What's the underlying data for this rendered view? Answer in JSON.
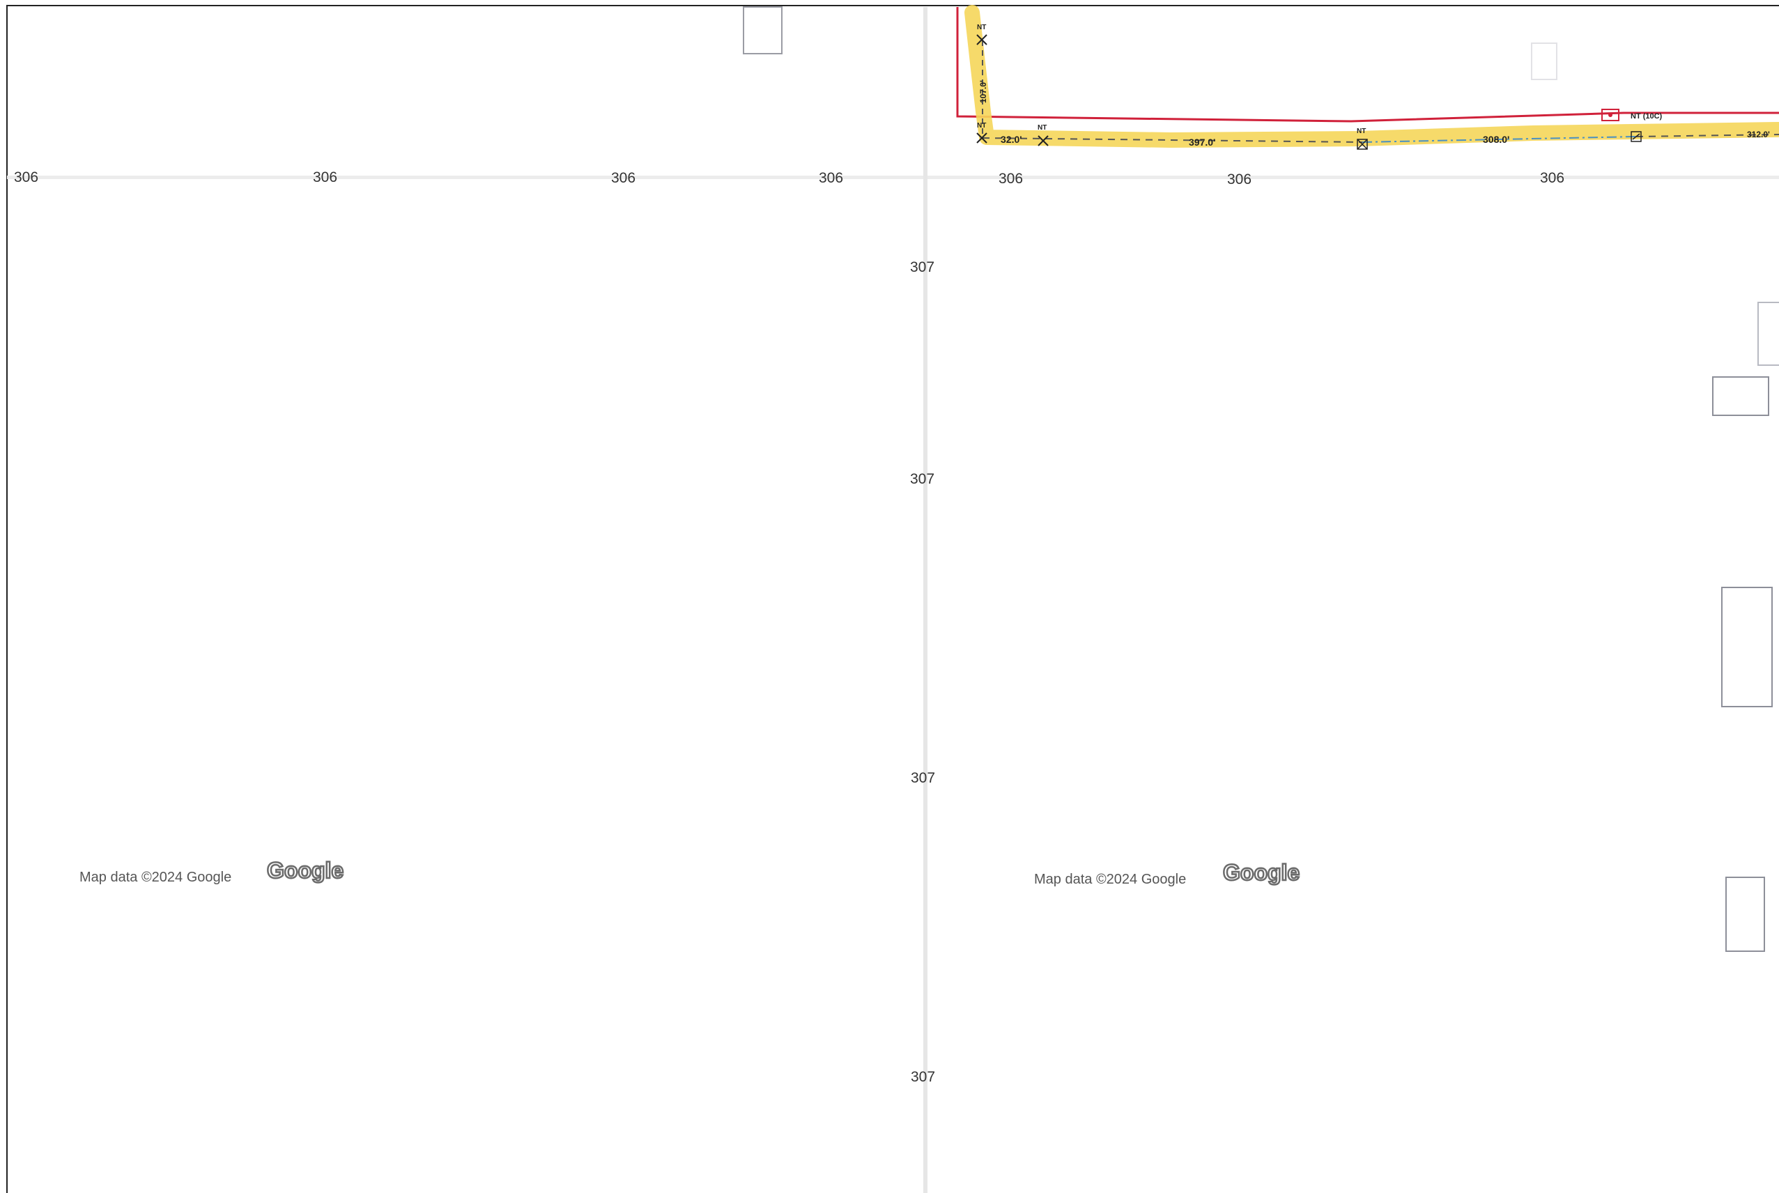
{
  "road_labels": {
    "horizontal": "306",
    "vertical": "307"
  },
  "attribution": {
    "left_text": "Map data ©2024 Google",
    "right_text": "Map data ©2024 Google",
    "logo_text": "Google"
  },
  "route": {
    "span_vertical": "107.0'",
    "span_short": "32.0'",
    "span_main": "397.0'",
    "span_mid": "308.0'",
    "span_right": "312.0'",
    "node_label": "NT",
    "node_label_right": "NT (10C)"
  },
  "colors": {
    "route_highlight": "#f5d65a",
    "boundary": "#d0213a",
    "road": "#e9e9e9",
    "span_line": "#4a90c2"
  }
}
